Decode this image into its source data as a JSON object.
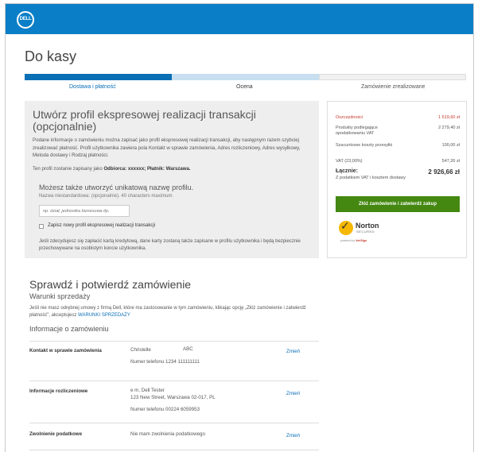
{
  "brand": {
    "logo_text": "DELL",
    "accent": "#0a7fc7"
  },
  "page": {
    "title": "Do kasy"
  },
  "steps": [
    {
      "label": "Dostawa i płatność",
      "state": "done"
    },
    {
      "label": "Ocena",
      "state": "current"
    },
    {
      "label": "Zamówienie zrealizowane",
      "state": "pending"
    }
  ],
  "progress": {
    "completed_fraction": 0.333,
    "check_icon": "check-icon"
  },
  "profile": {
    "title": "Utwórz profil ekspresowej realizacji transakcji (opcjonalnie)",
    "description": "Podane informacje o zamówieniu można zapisać jako profil ekspresowej realizacji transakcji, aby następnym razem szybciej zrealizować płatność. Profil użytkownika zawiera pola Kontakt w sprawie zamówienia, Adres rozliczeniowy, Adres wysyłkowy, Metoda dostawy i Rodzaj płatności.",
    "saved_prefix": "Ten profil zostanie zapisany jako",
    "saved_value": "Odbiorca: xxxxxx; Płatnik: Warszawa.",
    "custom_name_heading": "Możesz także utworzyć unikatową nazwę profilu.",
    "custom_name_hint": "Nazwa niestandardowa: (opcjonalnie). 40 characters maximum.",
    "input_placeholder": "np. dział, jednostka biznesowa itp.",
    "checkbox_label": "Zapisz nowy profil ekspresowej realizacji transakcji",
    "checkbox_checked": false,
    "card_note": "Jeśli zdecydujesz się zapłacić kartą kredytową, dane karty zostaną także zapisane w profilu użytkownika i będą bezpiecznie przechowywane na osobistym koncie użytkownika."
  },
  "summary": {
    "rows": [
      {
        "label": "Oszczędności",
        "value": "1 519,60 zł",
        "highlight": true
      },
      {
        "label": "Produkty podlegające opodatkowaniu VAT",
        "value": "2 279,40 zł",
        "highlight": false
      },
      {
        "label": "Szacunkowe koszty przesyłki",
        "value": "100,00 zł",
        "highlight": false
      },
      {
        "label": "VAT (23,00%)",
        "value": "547,26 zł",
        "highlight": false
      }
    ],
    "total_label": "Łącznie:",
    "total_value": "2 926,66 zł",
    "total_sub": "Z podatkiem VAT i kosztem dostawy",
    "place_order_label": "Złóż zamówienie i zatwierdź zakup",
    "button_color": "#448811",
    "highlight_color": "#c0392b",
    "norton": {
      "name": "Norton",
      "secured": "SECURED",
      "powered_by": "powered by",
      "verisign": "VeriSign"
    }
  },
  "review": {
    "title": "Sprawdź i potwierdź zamówienie",
    "terms_heading": "Warunki sprzedaży",
    "terms_text": "Jeśli nie masz odrębnej umowy z firmą Dell, które ma zastosowanie w tym zamówieniu, klikając opcję „Złóż zamówienie i zatwierdź płatność”, akceptujesz",
    "terms_link": "WARUNKI SPRZEDAŻY",
    "info_heading": "Informacje o zamówieniu",
    "sections": [
      {
        "label": "Kontakt w sprawie zamówienia",
        "line1": "Christelle",
        "line1b": "ABC",
        "line2": "Numer telefonu 1234 111111111",
        "line3": "",
        "edit": "Zmień"
      },
      {
        "label": "Informacje rozliczeniowe",
        "line1": "e m, Dell Tester",
        "line1b": "",
        "line2": "123 New Street, Warszawa 02-017, PL",
        "line3": "Numer telefonu 00224 6059953",
        "edit": "Zmień"
      },
      {
        "label": "Zwolnienie podatkowe",
        "line1": "Nie mam zwolnienia podatkowego",
        "line1b": "",
        "line2": "",
        "line3": "",
        "edit": "Zmień"
      }
    ]
  }
}
